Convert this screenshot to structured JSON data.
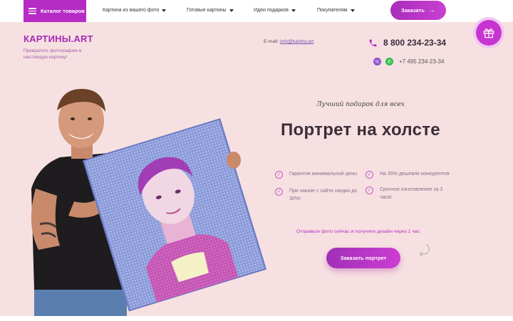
{
  "topnav": {
    "catalog_label": "Каталог товаров",
    "items": [
      {
        "label": "Картина из вашего фото"
      },
      {
        "label": "Готовые картины"
      },
      {
        "label": "Идеи подарков"
      },
      {
        "label": "Покупателям"
      }
    ],
    "order_label": "Заказать"
  },
  "header": {
    "logo": "КАРТИНЫ.ART",
    "tagline": "Превратить фотографию в настоящую картину!",
    "email_prefix": "E-mail: ",
    "email": "info@kartiny.art",
    "phone_main": "8 800 234-23-34",
    "phone_secondary": "+7 495 234-23-34"
  },
  "hero": {
    "subtitle": "Лучший подарок для всех",
    "title": "Портрет на холсте",
    "features": [
      "Гарантия минимальной цены",
      "На 30% дешевле конкурентов",
      "При заказе с сайта скидки до 30%!",
      "Срочное изготовление за 3 часа!"
    ],
    "cta_text": "Отправьте фото сейчас и получите дизайн через 1 час",
    "cta_button": "Заказать портрет"
  },
  "colors": {
    "accent": "#b62bc4",
    "hero_bg": "#f7e0e1",
    "title": "#3b2d37"
  },
  "icons": [
    "menu-icon",
    "chevron-down-icon",
    "arrow-right-icon",
    "phone-icon",
    "viber-icon",
    "whatsapp-icon",
    "gift-icon",
    "check-icon",
    "curved-arrow-icon"
  ]
}
